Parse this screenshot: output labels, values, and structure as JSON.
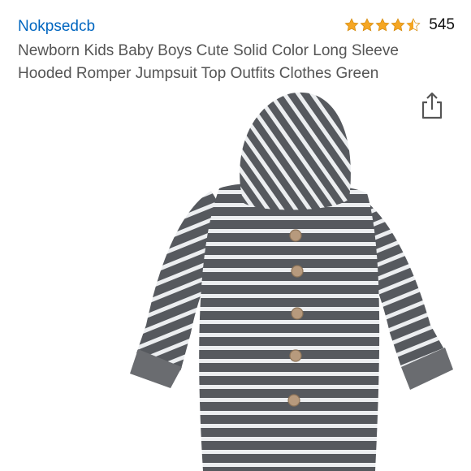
{
  "product": {
    "brand": "Nokpsedcb",
    "rating_count": "545",
    "rating_value": 4.5,
    "title": "Newborn Kids Baby Boys Cute Solid Color Long Sleeve Hooded Romper Jumpsuit Top Outfits Clothes Green"
  },
  "colors": {
    "brand_link": "#0066c0",
    "star": "#f5a623",
    "title_text": "#555555",
    "romper_dark": "#56595e",
    "romper_stripe": "#eceef0",
    "button_wood": "#b79a7d"
  },
  "icons": {
    "share": "share-icon",
    "star": "star-icon"
  }
}
